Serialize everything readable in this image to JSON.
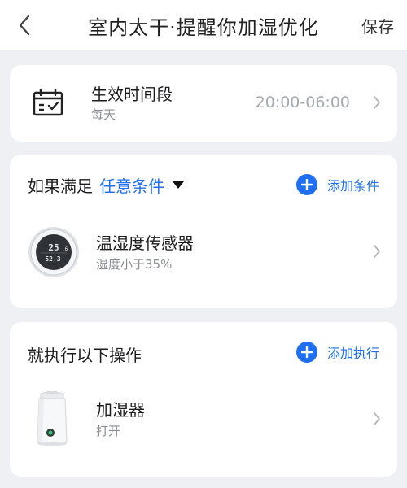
{
  "header": {
    "title": "室内太干·提醒你加湿优化",
    "save_label": "保存"
  },
  "schedule": {
    "label": "生效时间段",
    "repeat": "每天",
    "time_range": "20:00-06:00"
  },
  "condition": {
    "prefix": "如果满足",
    "mode": "任意条件",
    "add_label": "添加条件",
    "item": {
      "name": "温湿度传感器",
      "detail": "湿度小于35%",
      "display_temp": "25",
      "display_temp_dec": ".6",
      "display_hum": "52.3"
    }
  },
  "action": {
    "title": "就执行以下操作",
    "add_label": "添加执行",
    "item": {
      "name": "加湿器",
      "detail": "打开"
    }
  },
  "colors": {
    "accent": "#1f6ff0",
    "background": "#eef0f3",
    "card": "#ffffff"
  }
}
